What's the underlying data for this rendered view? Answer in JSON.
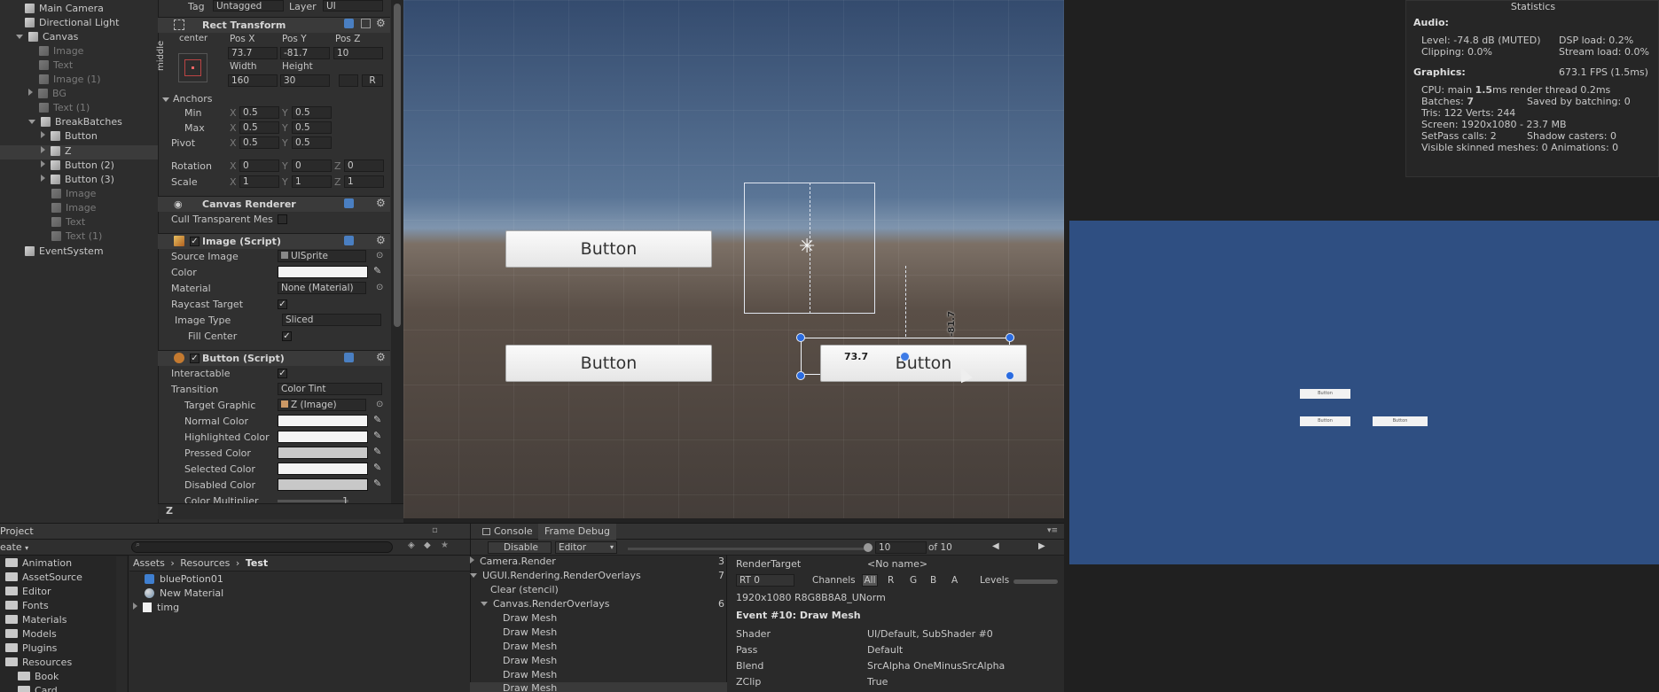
{
  "hierarchy": {
    "items": [
      {
        "label": "Main Camera"
      },
      {
        "label": "Directional Light"
      },
      {
        "label": "Canvas"
      },
      {
        "label": "Image"
      },
      {
        "label": "Text"
      },
      {
        "label": "Image (1)"
      },
      {
        "label": "BG"
      },
      {
        "label": "Text (1)"
      },
      {
        "label": "BreakBatches"
      },
      {
        "label": "Button"
      },
      {
        "label": "Z"
      },
      {
        "label": "Button (2)"
      },
      {
        "label": "Button (3)"
      },
      {
        "label": "Image"
      },
      {
        "label": "Image"
      },
      {
        "label": "Text"
      },
      {
        "label": "Text (1)"
      },
      {
        "label": "EventSystem"
      }
    ]
  },
  "inspector": {
    "tag_label": "Tag",
    "tag_value": "Untagged",
    "layer_label": "Layer",
    "layer_value": "UI",
    "rect_transform": {
      "title": "Rect Transform",
      "anchor_label_top": "center",
      "anchor_label_side": "middle",
      "posx_label": "Pos X",
      "posy_label": "Pos Y",
      "posz_label": "Pos Z",
      "posx": "73.7",
      "posy": "-81.7",
      "posz": "10",
      "width_label": "Width",
      "height_label": "Height",
      "width": "160",
      "height": "30",
      "r_label": "R"
    },
    "anchors": {
      "title": "Anchors",
      "min_label": "Min",
      "max_label": "Max",
      "pivot_label": "Pivot",
      "x": "X",
      "y": "Y",
      "z": "Z",
      "min_x": "0.5",
      "min_y": "0.5",
      "max_x": "0.5",
      "max_y": "0.5",
      "pivot_x": "0.5",
      "pivot_y": "0.5"
    },
    "rotation": {
      "label": "Rotation",
      "x": "0",
      "y": "0",
      "z": "0"
    },
    "scale": {
      "label": "Scale",
      "x": "1",
      "y": "1",
      "z": "1"
    },
    "canvas_renderer": {
      "title": "Canvas Renderer",
      "cull_label": "Cull Transparent Mes"
    },
    "image_script": {
      "title": "Image (Script)",
      "source_label": "Source Image",
      "source_value": "UISprite",
      "color_label": "Color",
      "material_label": "Material",
      "material_value": "None (Material)",
      "raycast_label": "Raycast Target",
      "type_label": "Image Type",
      "type_value": "Sliced",
      "fill_label": "Fill Center"
    },
    "button_script": {
      "title": "Button (Script)",
      "interactable_label": "Interactable",
      "transition_label": "Transition",
      "transition_value": "Color Tint",
      "target_label": "Target Graphic",
      "target_value": "Z (Image)",
      "normal_label": "Normal Color",
      "highlighted_label": "Highlighted Color",
      "pressed_label": "Pressed Color",
      "selected_label": "Selected Color",
      "disabled_label": "Disabled Color",
      "multiplier_label": "Color Multiplier",
      "multiplier_value": "1"
    },
    "footer_label": "Z"
  },
  "scene": {
    "button_label": "Button",
    "pos_readout": "73.7",
    "height_readout": "-81.7"
  },
  "stats": {
    "title": "Statistics",
    "audio": "Audio:",
    "audio_level": "Level: -74.8 dB (MUTED)",
    "dsp": "DSP load: 0.2%",
    "clipping": "Clipping: 0.0%",
    "stream": "Stream load: 0.0%",
    "graphics": "Graphics:",
    "fps": "673.1 FPS (1.5ms)",
    "cpu": "CPU: main",
    "cpu_main": "1.5",
    "cpu_rest": "ms  render thread 0.2ms",
    "batches_label": "Batches:",
    "batches": "7",
    "saved": "Saved by batching: 0",
    "tris": "Tris: 122  Verts: 244",
    "screen": "Screen: 1920x1080 - 23.7 MB",
    "setpass": "SetPass calls: 2",
    "shadow": "Shadow casters: 0",
    "skinned": "Visible skinned meshes: 0  Animations: 0"
  },
  "game_view": {
    "mini_label": "Button"
  },
  "project": {
    "title": "Project",
    "create": "eate",
    "folders": [
      {
        "label": "Animation"
      },
      {
        "label": "AssetSource"
      },
      {
        "label": "Editor"
      },
      {
        "label": "Fonts"
      },
      {
        "label": "Materials"
      },
      {
        "label": "Models"
      },
      {
        "label": "Plugins"
      },
      {
        "label": "Resources"
      },
      {
        "label": "Book"
      },
      {
        "label": "Card"
      }
    ],
    "breadcrumb": [
      "Assets",
      "Resources",
      "Test"
    ],
    "assets": [
      {
        "label": "bluePotion01"
      },
      {
        "label": "New Material"
      },
      {
        "label": "timg"
      }
    ]
  },
  "frame_debug": {
    "console_tab": "Console",
    "frame_tab": "Frame Debug",
    "disable": "Disable",
    "editor": "Editor",
    "step": "10",
    "of": "of 10",
    "tree": [
      {
        "label": "Camera.Render",
        "count": "3"
      },
      {
        "label": "UGUI.Rendering.RenderOverlays",
        "count": "7"
      },
      {
        "label": "Clear (stencil)",
        "count": ""
      },
      {
        "label": "Canvas.RenderOverlays",
        "count": "6"
      },
      {
        "label": "Draw Mesh",
        "count": ""
      },
      {
        "label": "Draw Mesh",
        "count": ""
      },
      {
        "label": "Draw Mesh",
        "count": ""
      },
      {
        "label": "Draw Mesh",
        "count": ""
      },
      {
        "label": "Draw Mesh",
        "count": ""
      },
      {
        "label": "Draw Mesh",
        "count": ""
      }
    ],
    "rendertarget_label": "RenderTarget",
    "rendertarget_value": "<No name>",
    "rt": "RT 0",
    "channels": "Channels",
    "ch_all": "All",
    "ch_r": "R",
    "ch_g": "G",
    "ch_b": "B",
    "ch_a": "A",
    "levels": "Levels",
    "format": "1920x1080 R8G8B8A8_UNorm",
    "event": "Event #10: Draw Mesh",
    "props": [
      {
        "k": "Shader",
        "v": "UI/Default, SubShader #0"
      },
      {
        "k": "Pass",
        "v": "Default"
      },
      {
        "k": "Blend",
        "v": "SrcAlpha OneMinusSrcAlpha"
      },
      {
        "k": "ZClip",
        "v": "True"
      }
    ]
  }
}
